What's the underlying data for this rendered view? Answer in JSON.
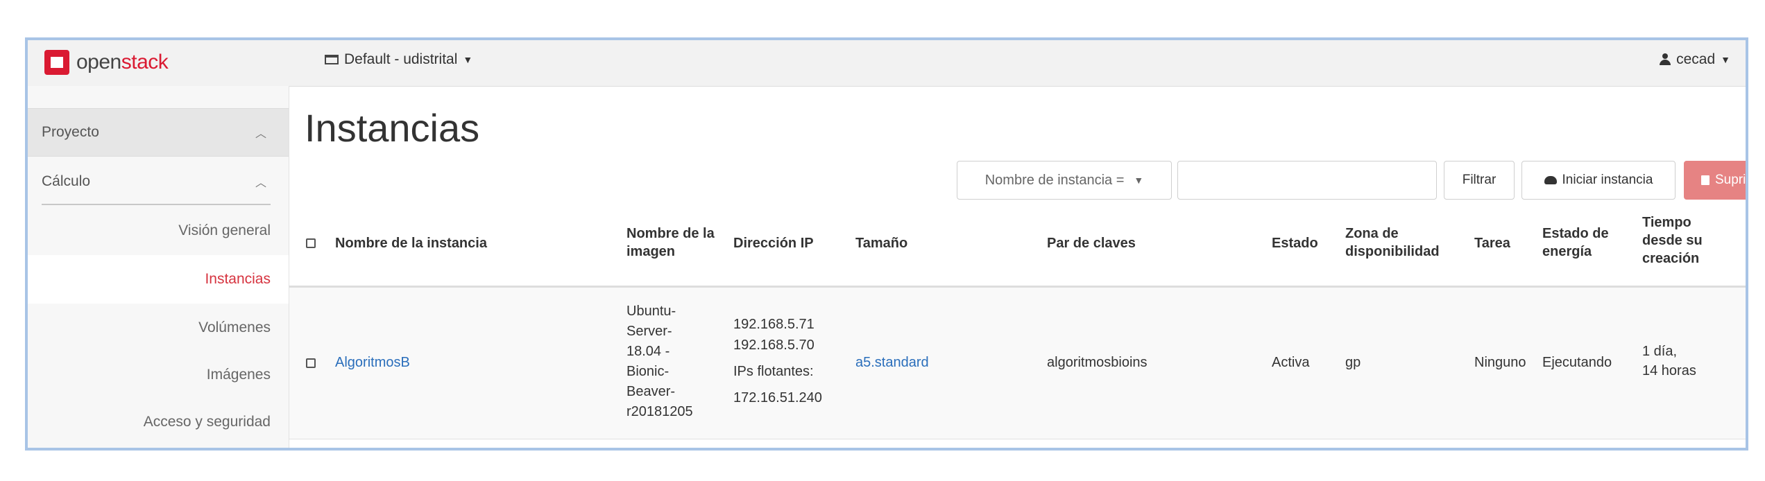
{
  "header": {
    "logo_prefix": "open",
    "logo_suffix": "stack",
    "project": "Default - udistrital",
    "user": "cecad"
  },
  "sidebar": {
    "section": "Proyecto",
    "subsection": "Cálculo",
    "items": [
      {
        "label": "Visión general"
      },
      {
        "label": "Instancias",
        "active": true
      },
      {
        "label": "Volúmenes"
      },
      {
        "label": "Imágenes"
      },
      {
        "label": "Acceso y seguridad"
      }
    ]
  },
  "main": {
    "title": "Instancias",
    "filter_select": "Nombre de instancia =",
    "filter_button": "Filtrar",
    "launch_button": "Iniciar instancia",
    "delete_button": "Suprimir in",
    "columns": [
      "Nombre de la instancia",
      "Nombre de la imagen",
      "Dirección IP",
      "Tamaño",
      "Par de claves",
      "Estado",
      "Zona de disponibilidad",
      "Tarea",
      "Estado de energía",
      "Tiempo desde su creación"
    ],
    "rows": [
      {
        "name": "AlgoritmosB",
        "image_lines": [
          "Ubuntu-",
          "Server-",
          "18.04 -",
          "Bionic-",
          "Beaver-",
          "r20181205"
        ],
        "ip_lines": [
          "192.168.5.71",
          "192.168.5.70",
          "IPs flotantes:",
          "172.16.51.240"
        ],
        "size": "a5.standard",
        "keypair": "algoritmosbioins",
        "status": "Activa",
        "zone": "gp",
        "task": "Ninguno",
        "power": "Ejecutando",
        "age_lines": [
          "1 día,",
          "14 horas"
        ]
      }
    ]
  },
  "colors": {
    "brand": "#da1a32",
    "link": "#2a6ebb",
    "active_nav": "#d6333f",
    "delete_button": "#e68383",
    "frame_border": "#a8c4e6"
  }
}
